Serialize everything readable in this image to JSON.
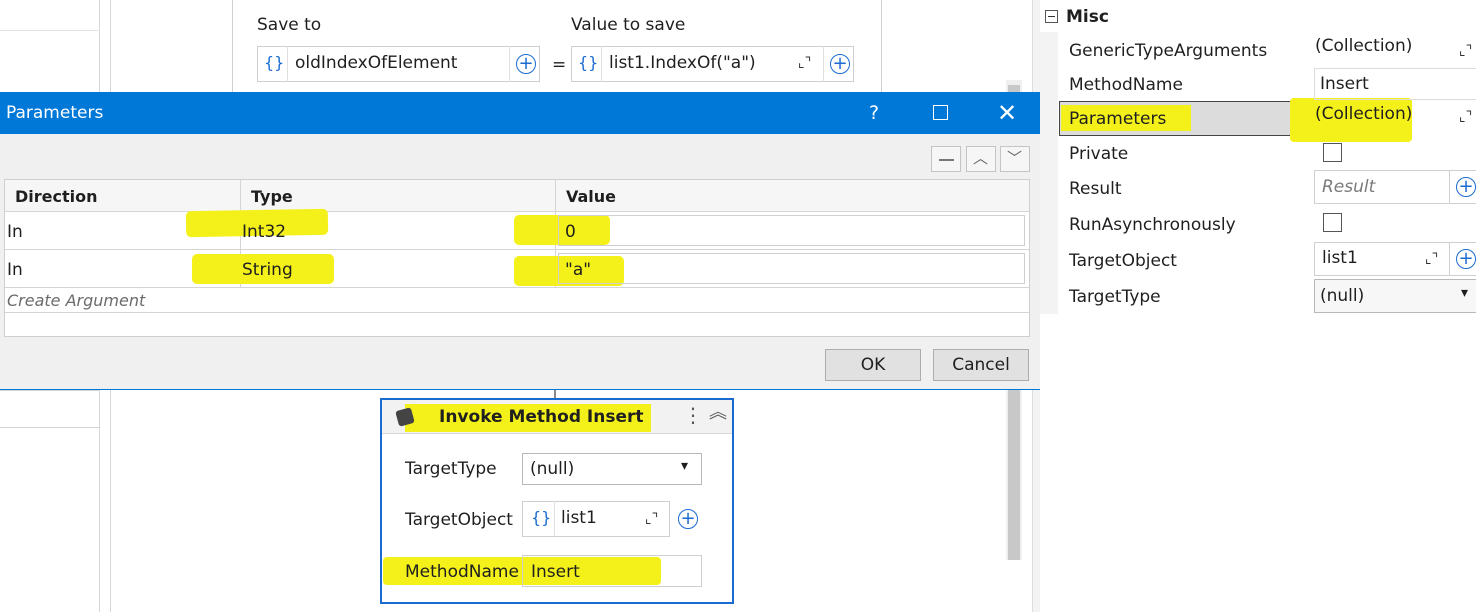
{
  "assign": {
    "save_to_label": "Save to",
    "value_to_save_label": "Value to save",
    "save_to_value": "oldIndexOfElement",
    "value_to_save_value": "list1.IndexOf(\"a\")",
    "equals": "="
  },
  "dialog": {
    "title": "Parameters",
    "help": "?",
    "columns": [
      "Direction",
      "Type",
      "Value"
    ],
    "rows": [
      {
        "direction": "In",
        "type": "Int32",
        "value": "0"
      },
      {
        "direction": "In",
        "type": "String",
        "value": "\"a\""
      }
    ],
    "create_argument": "Create Argument",
    "ok": "OK",
    "cancel": "Cancel"
  },
  "activity": {
    "title": "Invoke Method Insert",
    "target_type_label": "TargetType",
    "target_type_value": "(null)",
    "target_object_label": "TargetObject",
    "target_object_value": "list1",
    "method_name_label": "MethodName",
    "method_name_value": "Insert"
  },
  "properties": {
    "section": "Misc",
    "rows": [
      {
        "label": "GenericTypeArguments",
        "value": "(Collection)"
      },
      {
        "label": "MethodName",
        "value": "Insert"
      },
      {
        "label": "Parameters",
        "value": "(Collection)"
      },
      {
        "label": "Private",
        "value": ""
      },
      {
        "label": "Result",
        "value": "Result"
      },
      {
        "label": "RunAsynchronously",
        "value": ""
      },
      {
        "label": "TargetObject",
        "value": "list1"
      },
      {
        "label": "TargetType",
        "value": "(null)"
      }
    ]
  },
  "colors": {
    "highlight": "#f4f11a",
    "dialog_title": "#0078d7",
    "accent": "#1a6bd0"
  }
}
